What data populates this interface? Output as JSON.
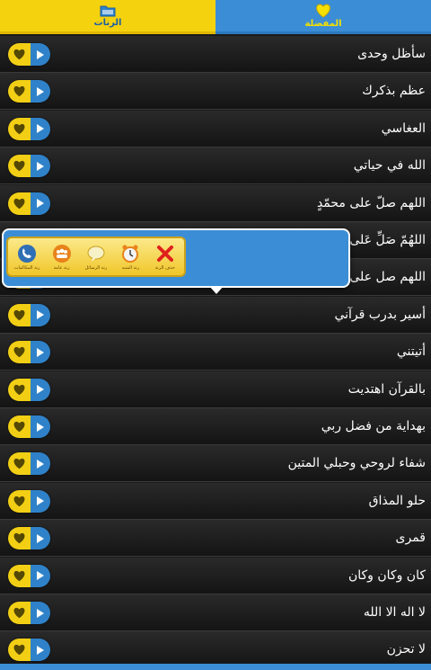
{
  "tabs": {
    "favorites": {
      "label": "المفضلة",
      "icon": "heart-icon",
      "color": "#3b8ed5"
    },
    "ringtones": {
      "label": "الرنات",
      "icon": "folder-icon",
      "color": "#f5d20e"
    }
  },
  "songs": [
    "سأظل وحدى",
    "عظم بذكرك",
    "العغاسي",
    "الله في حياتي",
    "اللهم صلّ على محمّدٍ",
    "اللهُمّ صَلِّ عَلى مُحَـ",
    "اللهم صل على محـ",
    "أسير بدرب قرآني",
    "أتيتني",
    "بالقرآن اهتديت",
    "بهداية من فضل ربي",
    "شفاء لروحي وحبلي المتين",
    "حلو المذاق",
    "قمرى",
    "كان وكان وكان",
    "لا اله الا الله",
    "لا تحزن"
  ],
  "popup_actions": [
    {
      "label": "حذف الرنة",
      "icon": "delete-x-icon"
    },
    {
      "label": "رنة المنبه",
      "icon": "alarm-clock-icon"
    },
    {
      "label": "رنة الرسائل",
      "icon": "message-bubble-icon"
    },
    {
      "label": "رنة عامة",
      "icon": "group-people-icon"
    },
    {
      "label": "رنة المكالمات",
      "icon": "phone-call-icon"
    }
  ],
  "colors": {
    "accent_blue": "#3b8ed5",
    "accent_yellow": "#f5d20e",
    "delete_red": "#e0201c"
  }
}
